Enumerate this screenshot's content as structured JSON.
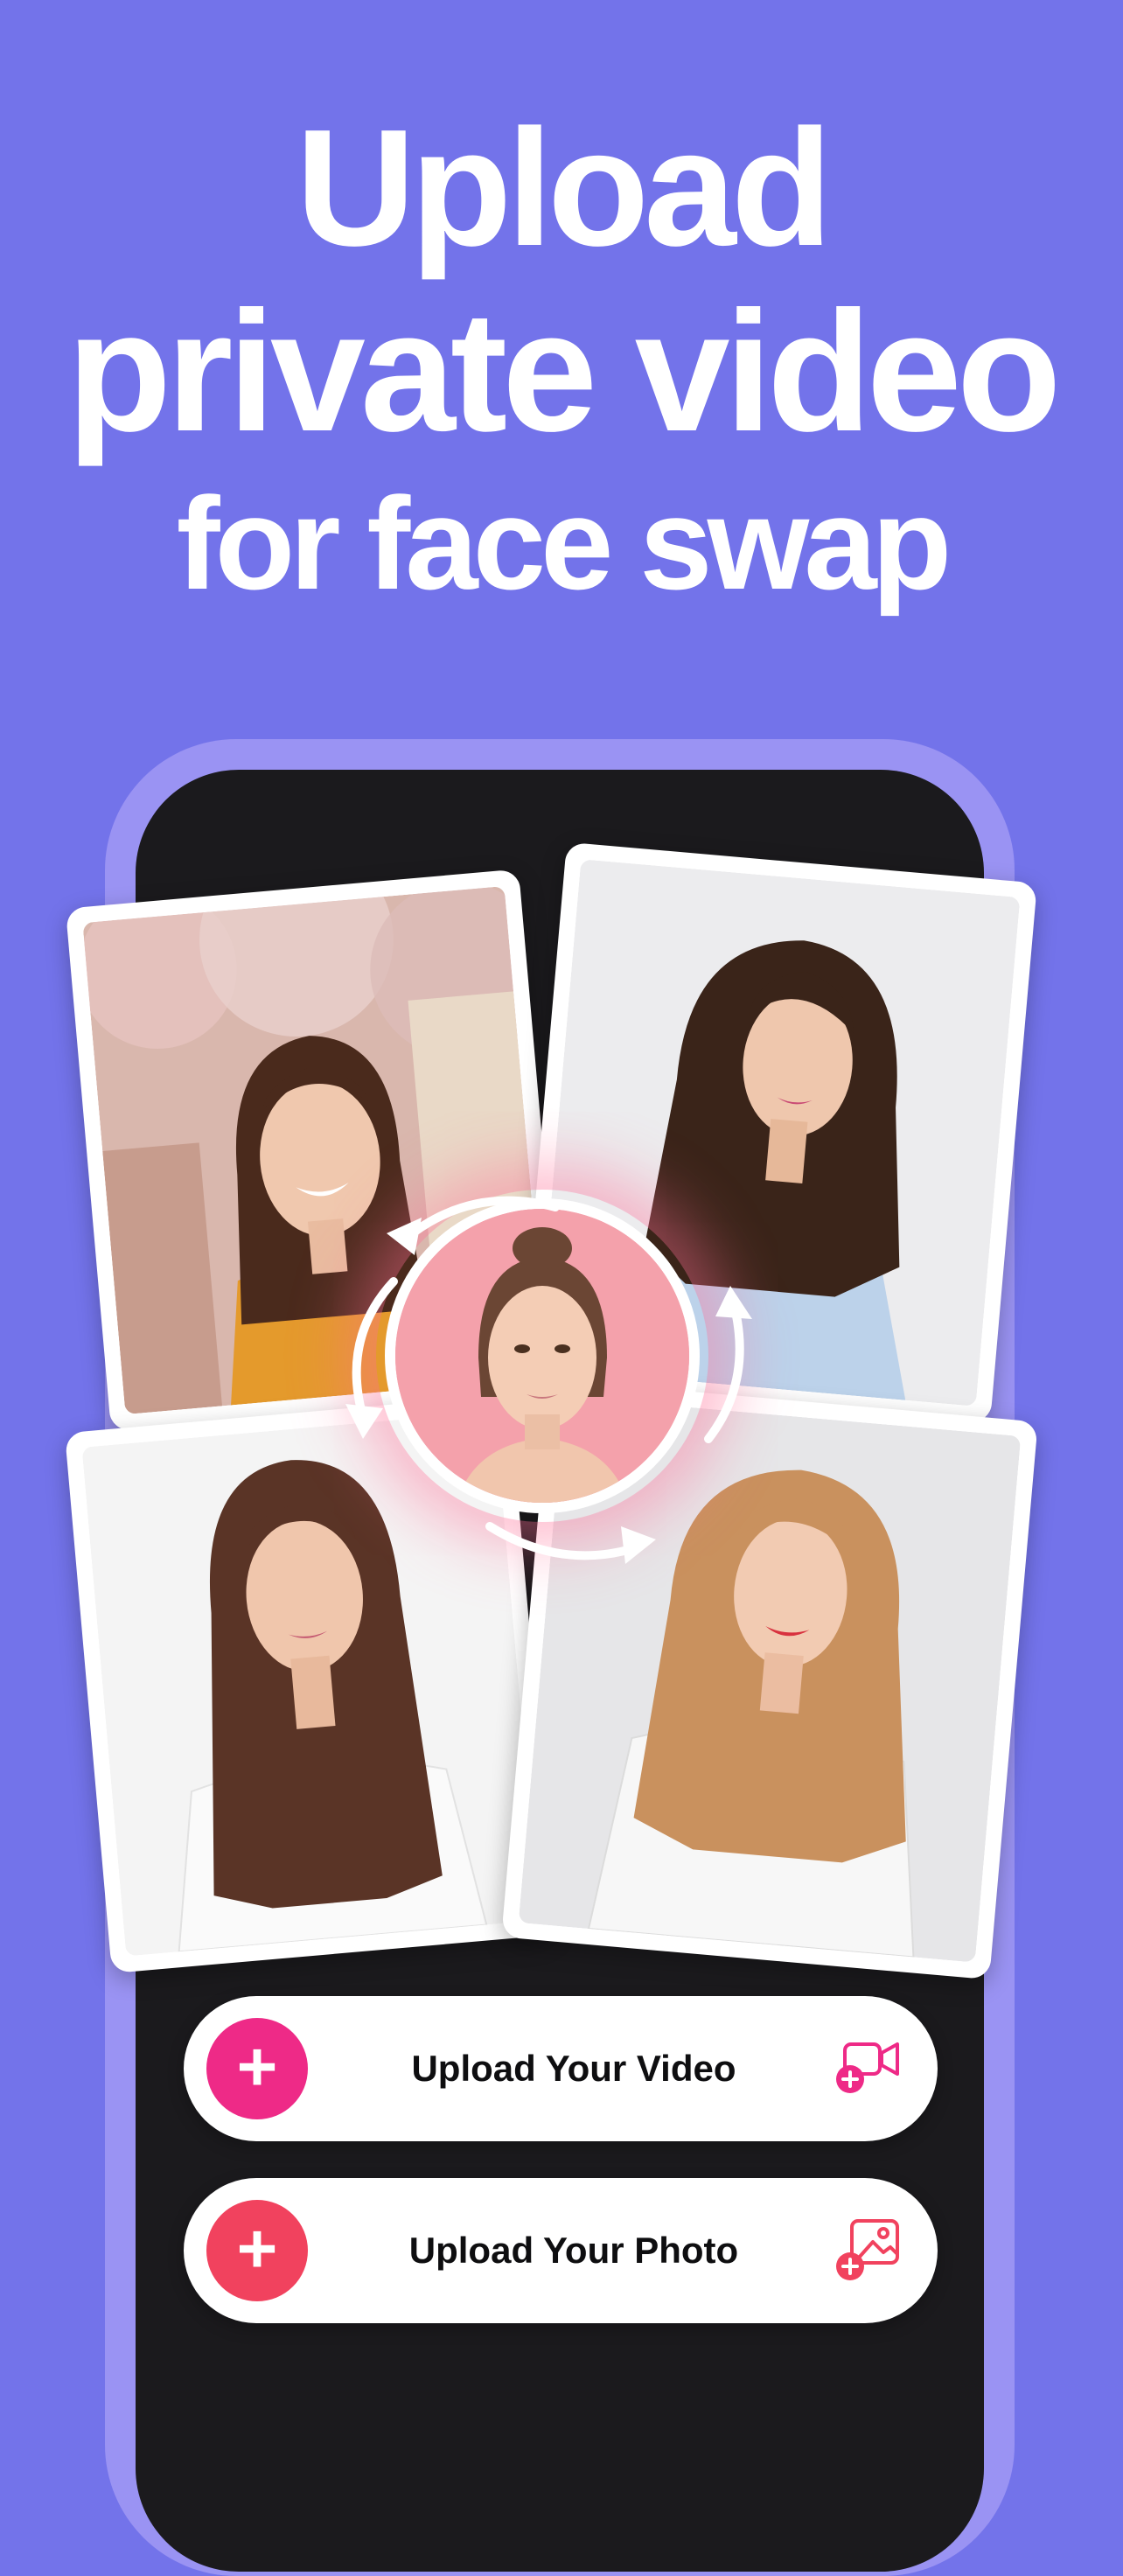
{
  "headline": {
    "line1": "Upload",
    "line2": "private video",
    "line3": "for face swap"
  },
  "buttons": {
    "upload_video": {
      "label": "Upload Your Video",
      "plus": "+",
      "icon": "video-add-icon",
      "color": "#ee2a87"
    },
    "upload_photo": {
      "label": "Upload Your Photo",
      "plus": "+",
      "icon": "image-add-icon",
      "color": "#f1425e"
    }
  },
  "colors": {
    "background": "#7373ea",
    "phone_frame": "#9a93f3",
    "phone_screen": "#1b1a1d",
    "accent_pink": "#ee2a87",
    "accent_red": "#f1425e"
  },
  "icons": {
    "swap": "swap-arrows-icon"
  }
}
